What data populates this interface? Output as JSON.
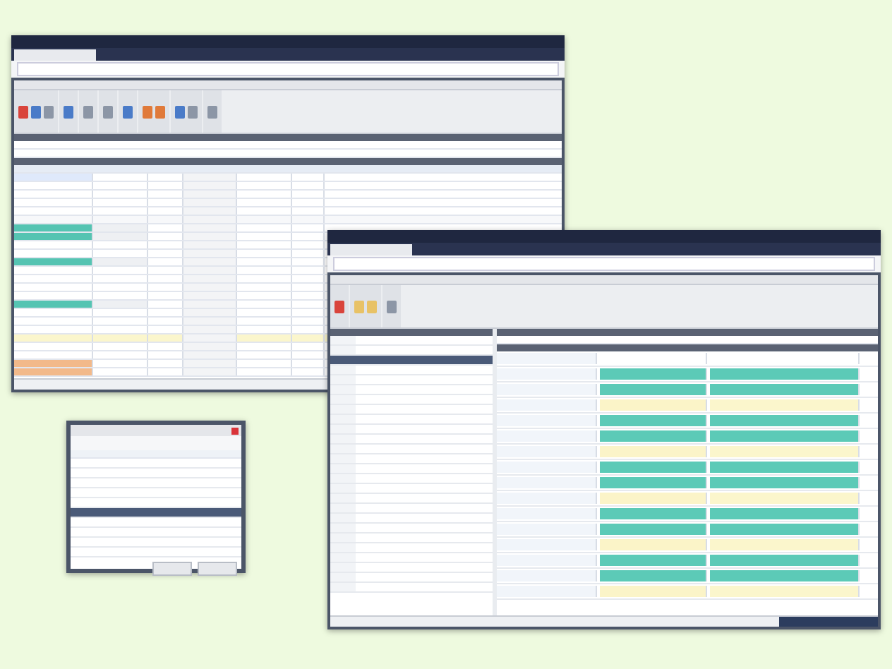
{
  "back_window": {
    "ribbon_groups": [
      {
        "icons": [
          {
            "color": "#d9443b"
          },
          {
            "color": "#4a7bc8"
          },
          {
            "color": "#8c96a6"
          }
        ]
      },
      {
        "icons": [
          {
            "color": "#4a7bc8"
          }
        ]
      },
      {
        "icons": [
          {
            "color": "#8c96a6"
          }
        ]
      },
      {
        "icons": [
          {
            "color": "#8c96a6"
          }
        ]
      },
      {
        "icons": [
          {
            "color": "#4a7bc8"
          }
        ]
      },
      {
        "icons": [
          {
            "color": "#e07a3a"
          },
          {
            "color": "#e07a3a"
          }
        ]
      },
      {
        "icons": [
          {
            "color": "#4a7bc8"
          },
          {
            "color": "#8c96a6"
          }
        ]
      },
      {
        "icons": [
          {
            "color": "#8c96a6"
          }
        ]
      }
    ],
    "rows": [
      {
        "kind": "selected"
      },
      {
        "kind": "plain"
      },
      {
        "kind": "plain"
      },
      {
        "kind": "plain"
      },
      {
        "kind": "plain"
      },
      {
        "kind": "gap"
      },
      {
        "kind": "teal"
      },
      {
        "kind": "teal"
      },
      {
        "kind": "plain"
      },
      {
        "kind": "plain"
      },
      {
        "kind": "teal"
      },
      {
        "kind": "plain"
      },
      {
        "kind": "plain"
      },
      {
        "kind": "plain"
      },
      {
        "kind": "plain"
      },
      {
        "kind": "teal"
      },
      {
        "kind": "plain"
      },
      {
        "kind": "plain"
      },
      {
        "kind": "plain"
      },
      {
        "kind": "yellow"
      },
      {
        "kind": "plain"
      },
      {
        "kind": "plain"
      },
      {
        "kind": "orange"
      },
      {
        "kind": "orange"
      }
    ]
  },
  "dialog": {
    "rows": [
      {
        "selected": false
      },
      {
        "selected": false
      },
      {
        "selected": false
      },
      {
        "selected": false
      },
      {
        "selected": false
      },
      {
        "selected": true
      },
      {
        "selected": false
      },
      {
        "selected": false
      },
      {
        "selected": false
      },
      {
        "selected": false
      }
    ]
  },
  "front_window": {
    "list": [
      {
        "selected": false
      },
      {
        "selected": false
      },
      {
        "selected": true
      },
      {
        "selected": false
      },
      {
        "selected": false
      },
      {
        "selected": false
      },
      {
        "selected": false
      },
      {
        "selected": false
      },
      {
        "selected": false
      },
      {
        "selected": false
      },
      {
        "selected": false
      },
      {
        "selected": false
      },
      {
        "selected": false
      },
      {
        "selected": false
      },
      {
        "selected": false
      },
      {
        "selected": false
      },
      {
        "selected": false
      },
      {
        "selected": false
      },
      {
        "selected": false
      },
      {
        "selected": false
      },
      {
        "selected": false
      },
      {
        "selected": false
      },
      {
        "selected": false
      },
      {
        "selected": false
      },
      {
        "selected": false
      },
      {
        "selected": false
      }
    ],
    "groups": [
      {
        "kind": "plain"
      },
      {
        "kind": "edit"
      },
      {
        "kind": "edit"
      },
      {
        "kind": "edit"
      },
      {
        "kind": "edit"
      },
      {
        "kind": "edit"
      }
    ]
  }
}
